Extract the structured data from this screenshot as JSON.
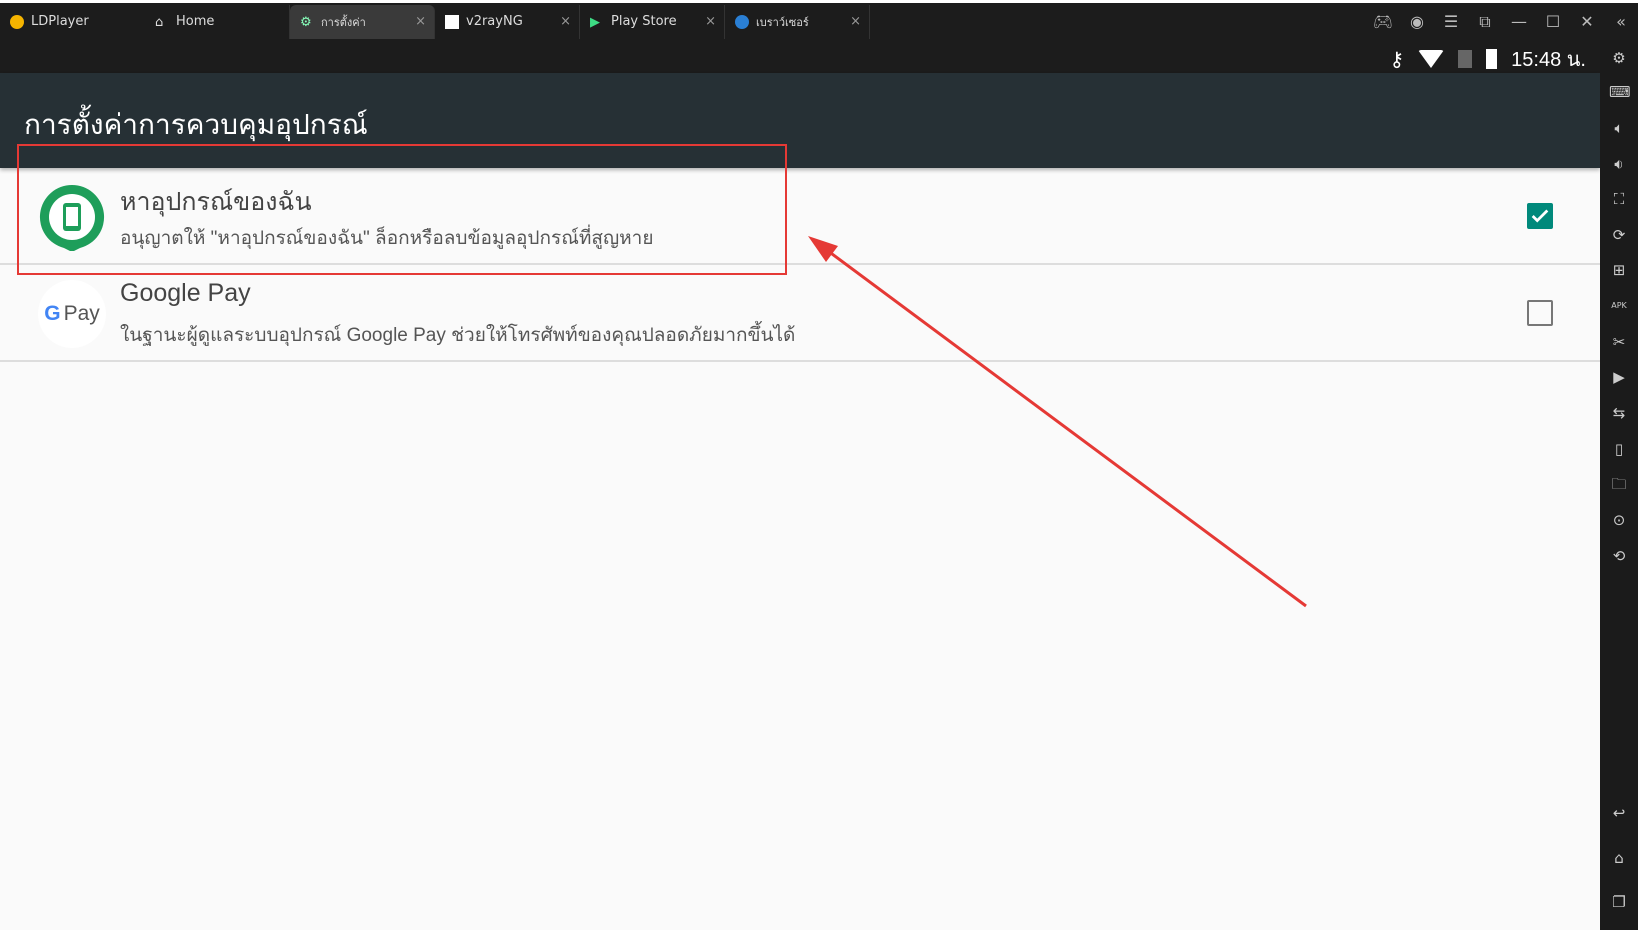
{
  "window": {
    "app_name": "LDPlayer",
    "tabs": [
      {
        "label": "Home",
        "icon": "home-icon"
      },
      {
        "label": "การตั้งค่า",
        "icon": "gear-icon",
        "active": true
      },
      {
        "label": "v2rayNG",
        "icon": "v2ray-icon"
      },
      {
        "label": "Play Store",
        "icon": "play-store-icon"
      },
      {
        "label": "เบราว์เซอร์",
        "icon": "globe-icon"
      }
    ],
    "close_glyph": "×"
  },
  "status": {
    "time": "15:48 น.",
    "icons": [
      "vpn-key-icon",
      "wifi-icon",
      "no-sim-icon",
      "battery-charging-icon"
    ]
  },
  "page": {
    "title": "การตั้งค่าการควบคุมอุปกรณ์"
  },
  "admins": [
    {
      "title": "หาอุปกรณ์ของฉัน",
      "subtitle": "อนุญาตให้ \"หาอุปกรณ์ของฉัน\" ล็อกหรือลบข้อมูลอุปกรณ์ที่สูญหาย",
      "checked": true,
      "icon": "find-my-device-icon"
    },
    {
      "title": "Google Pay",
      "subtitle": "ในฐานะผู้ดูแลระบบอุปกรณ์ Google Pay ช่วยให้โทรศัพท์ของคุณปลอดภัยมากขึ้นได้",
      "checked": false,
      "icon": "google-pay-icon",
      "icon_text": "Pay"
    }
  ],
  "colors": {
    "accent": "#00897b",
    "annotation": "#e53935",
    "appbar": "#263035"
  }
}
